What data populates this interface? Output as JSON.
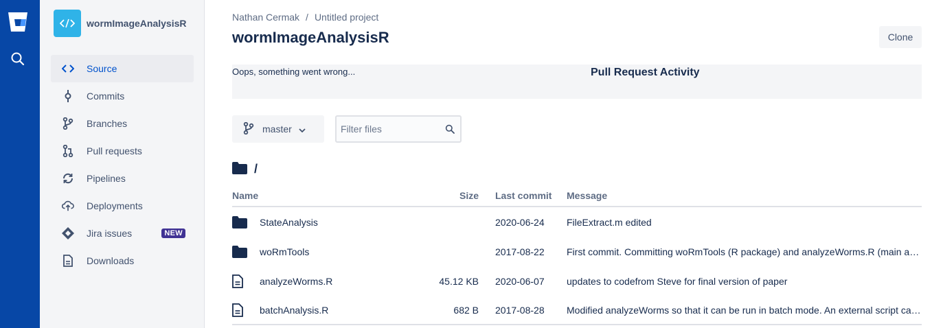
{
  "repo": {
    "name": "wormImageAnalysisR"
  },
  "sidebar": {
    "items": [
      {
        "label": "Source",
        "icon": "code-icon",
        "active": true
      },
      {
        "label": "Commits",
        "icon": "commit-icon"
      },
      {
        "label": "Branches",
        "icon": "branch-icon"
      },
      {
        "label": "Pull requests",
        "icon": "pull-request-icon"
      },
      {
        "label": "Pipelines",
        "icon": "pipelines-icon"
      },
      {
        "label": "Deployments",
        "icon": "deployments-icon"
      },
      {
        "label": "Jira issues",
        "icon": "jira-icon",
        "badge": "NEW"
      },
      {
        "label": "Downloads",
        "icon": "downloads-icon"
      }
    ]
  },
  "breadcrumb": {
    "owner": "Nathan Cermak",
    "separator": "/",
    "project": "Untitled project"
  },
  "header": {
    "title": "wormImageAnalysisR",
    "clone_label": "Clone"
  },
  "error_panel": {
    "message": "Oops, something went wrong...",
    "heading": "Pull Request Activity"
  },
  "branch": {
    "name": "master"
  },
  "filter": {
    "placeholder": "Filter files"
  },
  "path": {
    "current": "/"
  },
  "table": {
    "headers": {
      "name": "Name",
      "size": "Size",
      "last_commit": "Last commit",
      "message": "Message"
    },
    "rows": [
      {
        "type": "folder",
        "name": "StateAnalysis",
        "size": "",
        "date": "2020-06-24",
        "message": "FileExtract.m edited"
      },
      {
        "type": "folder",
        "name": "woRmTools",
        "size": "",
        "date": "2017-08-22",
        "message": "First commit. Committing woRmTools (R package) and analyzeWorms.R (main analysis script)"
      },
      {
        "type": "file",
        "name": "analyzeWorms.R",
        "size": "45.12 KB",
        "date": "2020-06-07",
        "message": "updates to codefrom Steve for final version of paper"
      },
      {
        "type": "file",
        "name": "batchAnalysis.R",
        "size": "682 B",
        "date": "2017-08-28",
        "message": "Modified analyzeWorms so that it can be run in batch mode. An external script can now call it"
      }
    ]
  },
  "colors": {
    "global_nav": "#0747a6",
    "accent": "#0052cc",
    "repo_avatar": "#2fb3e8",
    "badge": "#403294"
  }
}
